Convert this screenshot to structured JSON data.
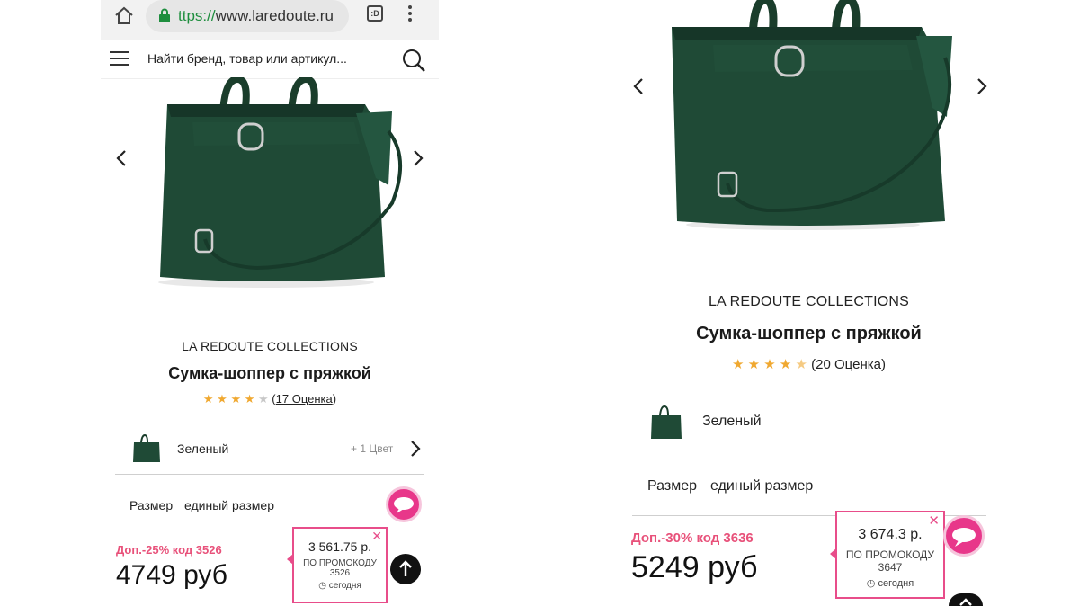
{
  "browser": {
    "url_scheme": "ttps://",
    "url_host": "www.laredoute.ru",
    "tab_badge": ":D"
  },
  "site_header": {
    "search_placeholder": "Найти бренд, товар или артикул..."
  },
  "left": {
    "brand": "LA REDOUTE COLLECTIONS",
    "title": "Сумка-шоппер с пряжкой",
    "stars": [
      1,
      1,
      1,
      1,
      0
    ],
    "reviews_link": "17 Оценка",
    "color_label": "Зеленый",
    "more_colors": "+ 1 Цвет",
    "size_label": "Размер",
    "size_value": "единый размер",
    "promo_code_text": "Доп.-25% код 3526",
    "price": "4749 руб",
    "promo_box": {
      "price": "3 561.75 р.",
      "line1": "ПО ПРОМОКОДУ",
      "line2": "3526",
      "today": "сегодня"
    }
  },
  "right": {
    "brand": "LA REDOUTE COLLECTIONS",
    "title": "Сумка-шоппер с пряжкой",
    "stars": [
      1,
      1,
      1,
      1,
      0.5
    ],
    "reviews_link": "20 Оценка",
    "color_label": "Зеленый",
    "size_label": "Размер",
    "size_value": "единый размер",
    "promo_code_text": "Доп.-30% код 3636",
    "price": "5249 руб",
    "promo_box": {
      "price": "3 674.3 р.",
      "line1": "ПО ПРОМОКОДУ",
      "line2": "3647",
      "today": "сегодня"
    }
  },
  "colors": {
    "accent_pink": "#e84d8a",
    "promo_text": "#e8517a",
    "star": "#f0a830",
    "bag_green": "#1f4a36",
    "url_green": "#1e8e3e"
  }
}
